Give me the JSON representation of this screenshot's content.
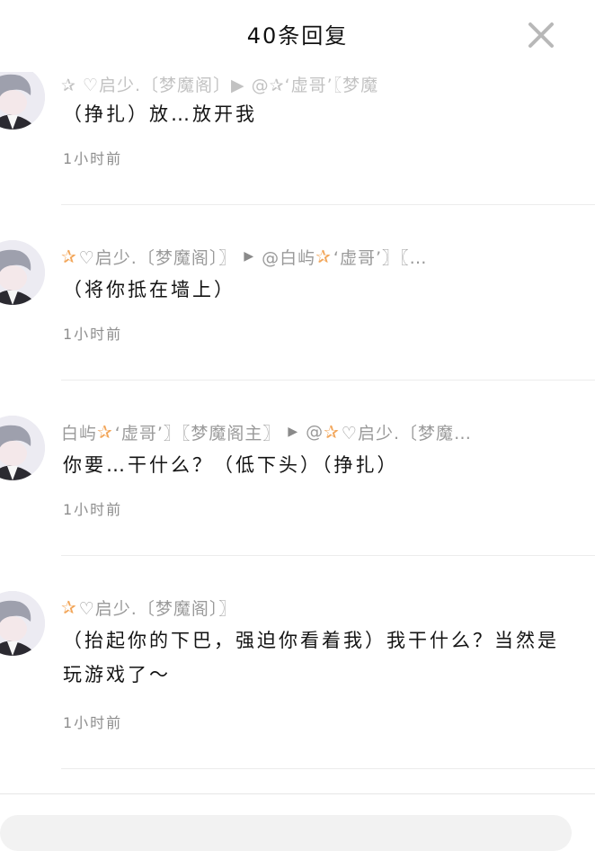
{
  "header": {
    "title": "40条回复"
  },
  "comments": [
    {
      "meta_partial": "✰ ♡启少.〔梦魔阁〕▶ @✰‘虚哥’〖梦魔",
      "text": "（挣扎）放…放开我",
      "time": "1小时前"
    },
    {
      "user_spark": "✰",
      "user": "♡启少.〔梦魔阁〕〗",
      "reply_to_prefix": "@白屿",
      "reply_to_spark": "✰",
      "reply_to_rest": "‘虚哥’〗〖…",
      "text": "（将你抵在墙上）",
      "time": "1小时前"
    },
    {
      "user": "白屿",
      "user_spark": "✰",
      "user_rest": "‘虚哥’〗〖梦魔阁主〗",
      "reply_to_prefix": "@",
      "reply_to_spark": "✰",
      "reply_to_rest": "♡启少.〔梦魔…",
      "text": "你要…干什么？（低下头）（挣扎）",
      "time": "1小时前"
    },
    {
      "user_spark": "✰",
      "user": "♡启少.〔梦魔阁〕〗",
      "text": "（抬起你的下巴，强迫你看着我）我干什么？当然是玩游戏了～",
      "time": "1小时前"
    }
  ],
  "colors": {
    "accent_spark": "#f2a65a",
    "meta_gray": "#9a9a9a",
    "divider": "#ececec"
  },
  "icons": {
    "close": "close-icon",
    "play_arrow": "play-arrow-icon"
  }
}
